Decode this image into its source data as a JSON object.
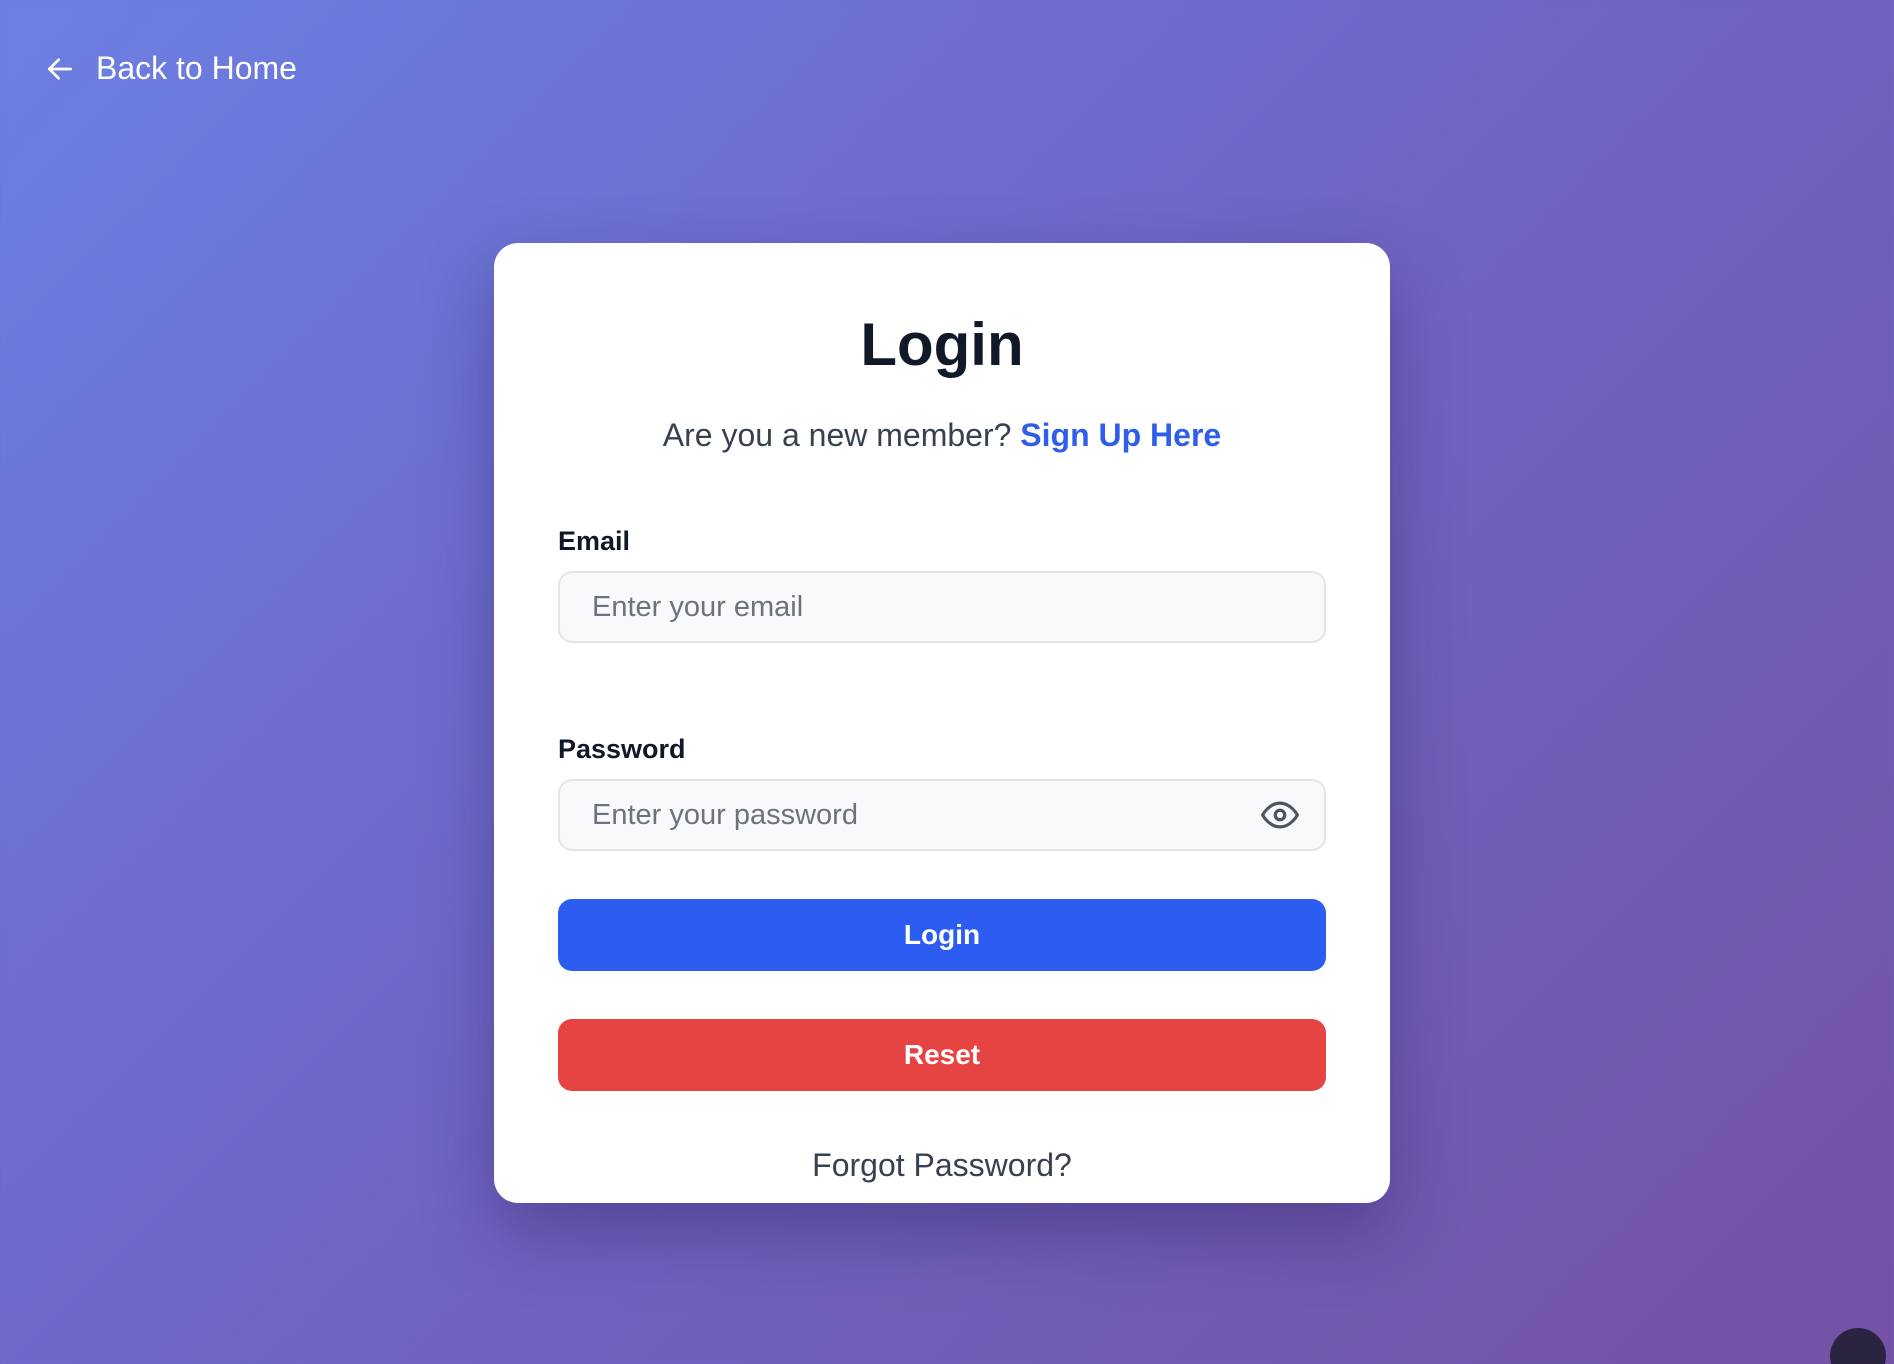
{
  "nav": {
    "back_label": "Back to Home",
    "back_icon": "arrow-left-icon"
  },
  "login_card": {
    "title": "Login",
    "subtitle_prefix": "Are you a new member?",
    "signup_link": "Sign Up Here",
    "email": {
      "label": "Email",
      "placeholder": "Enter your email",
      "value": ""
    },
    "password": {
      "label": "Password",
      "placeholder": "Enter your password",
      "value": "",
      "toggle_icon": "eye-icon"
    },
    "login_button": "Login",
    "reset_button": "Reset",
    "forgot_link": "Forgot Password?"
  },
  "colors": {
    "gradient_start": "#6b7fe3",
    "gradient_end": "#7352a6",
    "primary": "#2d5cf0",
    "danger": "#e64343",
    "link": "#2f5fe9"
  }
}
